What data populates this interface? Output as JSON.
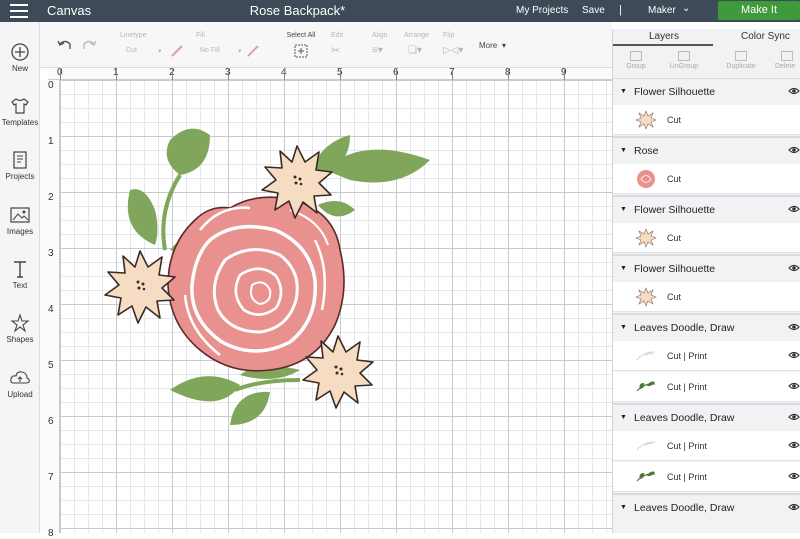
{
  "topbar": {
    "app_name": "Canvas",
    "doc_title": "Rose Backpack*",
    "my_projects": "My Projects",
    "save": "Save",
    "separator": "|",
    "machine": "Maker",
    "make_it": "Make It"
  },
  "sidebar": {
    "items": [
      {
        "label": "New",
        "icon": "plus-circle-icon"
      },
      {
        "label": "Templates",
        "icon": "shirt-icon"
      },
      {
        "label": "Projects",
        "icon": "projects-icon"
      },
      {
        "label": "Images",
        "icon": "image-icon"
      },
      {
        "label": "Text",
        "icon": "text-icon"
      },
      {
        "label": "Shapes",
        "icon": "shapes-icon"
      },
      {
        "label": "Upload",
        "icon": "upload-icon"
      }
    ]
  },
  "toolbar": {
    "linetype_label": "Linetype",
    "linetype_value": "Cut",
    "fill_label": "Fill",
    "fill_value": "No Fill",
    "select_all": "Select All",
    "edit": "Edit",
    "align": "Align",
    "arrange": "Arrange",
    "flip": "Flip",
    "more": "More"
  },
  "ruler": {
    "top": [
      "0",
      "1",
      "2",
      "3",
      "4",
      "5",
      "6",
      "7",
      "8",
      "9"
    ],
    "left": [
      "0",
      "1",
      "2",
      "3",
      "4",
      "5",
      "6",
      "7",
      "8"
    ]
  },
  "panel": {
    "tabs": [
      "Layers",
      "Color Sync"
    ],
    "actions": [
      "Group",
      "UnGroup",
      "Duplicate",
      "Delete"
    ],
    "groups": [
      {
        "name": "Flower Silhouette",
        "rows": [
          {
            "op": "Cut",
            "thumb": "flower"
          }
        ]
      },
      {
        "name": "Rose",
        "rows": [
          {
            "op": "Cut",
            "thumb": "rose"
          }
        ]
      },
      {
        "name": "Flower Silhouette",
        "rows": [
          {
            "op": "Cut",
            "thumb": "flower"
          }
        ]
      },
      {
        "name": "Flower Silhouette",
        "rows": [
          {
            "op": "Cut",
            "thumb": "flower"
          }
        ]
      },
      {
        "name": "Leaves Doodle, Draw",
        "rows": [
          {
            "op": "Cut  |  Print",
            "thumb": "doodle"
          },
          {
            "op": "Cut  |  Print",
            "thumb": "leaf"
          }
        ]
      },
      {
        "name": "Leaves Doodle, Draw",
        "rows": [
          {
            "op": "Cut  |  Print",
            "thumb": "doodle"
          },
          {
            "op": "Cut  |  Print",
            "thumb": "leaf"
          }
        ]
      },
      {
        "name": "Leaves Doodle, Draw",
        "rows": []
      }
    ]
  },
  "colors": {
    "topbar": "#3e4a58",
    "make_it": "#3f9a3c",
    "rose": "#e8918e",
    "flower": "#f7dcc4",
    "leaf": "#7fa65a"
  }
}
